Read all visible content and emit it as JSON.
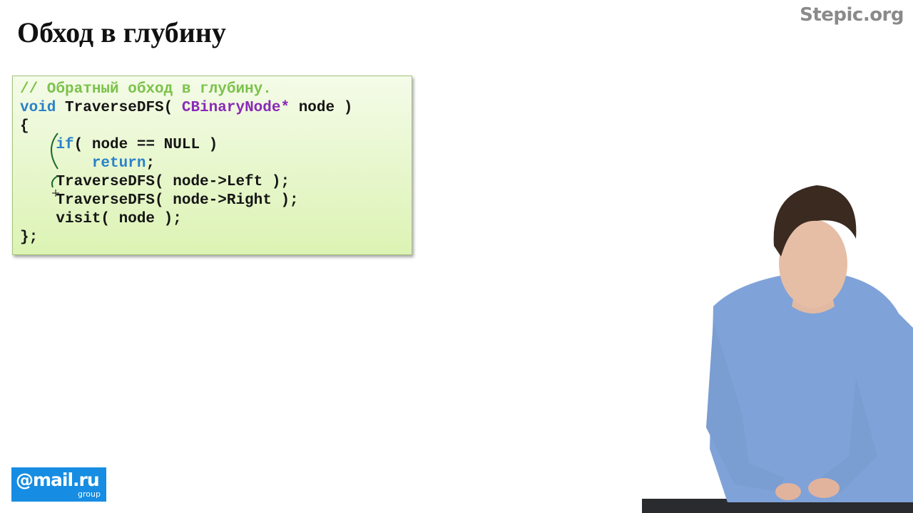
{
  "slide": {
    "title": "Обход в глубину",
    "brand": "Stepic.org"
  },
  "code": {
    "lines": [
      [
        {
          "t": "// Обратный обход в глубину.",
          "c": "cm"
        }
      ],
      [
        {
          "t": "void",
          "c": "kw"
        },
        {
          "t": " TraverseDFS( ",
          "c": ""
        },
        {
          "t": "CBinaryNode*",
          "c": "ty"
        },
        {
          "t": " node )",
          "c": ""
        }
      ],
      [
        {
          "t": "{",
          "c": ""
        }
      ],
      [
        {
          "t": "    ",
          "c": ""
        },
        {
          "t": "if",
          "c": "kw"
        },
        {
          "t": "( node == NULL )",
          "c": ""
        }
      ],
      [
        {
          "t": "        ",
          "c": ""
        },
        {
          "t": "return",
          "c": "kw"
        },
        {
          "t": ";",
          "c": ""
        }
      ],
      [
        {
          "t": "    TraverseDFS( node->Left );",
          "c": ""
        }
      ],
      [
        {
          "t": "    TraverseDFS( node->Right );",
          "c": ""
        }
      ],
      [
        {
          "t": "    visit( node );",
          "c": ""
        }
      ],
      [
        {
          "t": "};",
          "c": ""
        }
      ]
    ]
  },
  "logo": {
    "main": "@mail.ru",
    "sub": "group"
  },
  "colors": {
    "comment": "#7cc24c",
    "keyword": "#2a82c9",
    "type": "#8a2ab7",
    "logo_bg": "#168de2",
    "box_border": "#a4c47a"
  }
}
